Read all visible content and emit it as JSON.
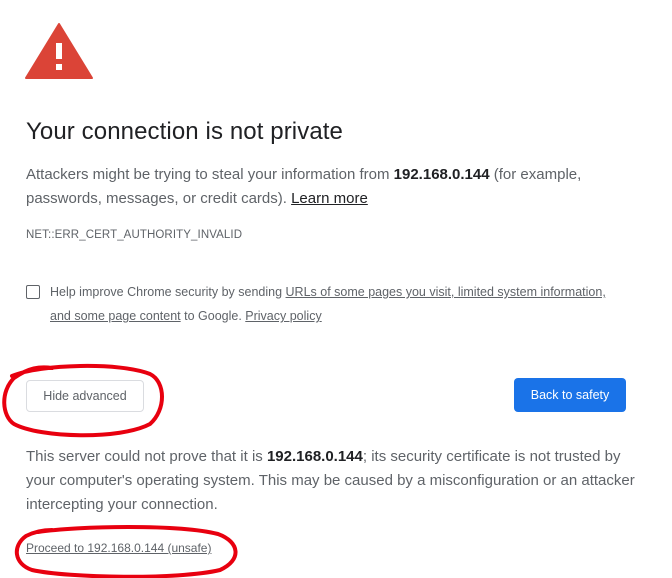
{
  "interstitial": {
    "headline": "Your connection is not private",
    "main_text": {
      "prefix": "Attackers might be trying to steal your information from ",
      "host": "192.168.0.144",
      "suffix": " (for example, passwords, messages, or credit cards). ",
      "learn_more": "Learn more"
    },
    "error_code": "NET::ERR_CERT_AUTHORITY_INVALID",
    "opt_in": {
      "checked": false,
      "prefix": "Help improve Chrome security by sending ",
      "link_text": "URLs of some pages you visit, limited system information, and some page content",
      "middle": " to Google. ",
      "privacy_policy": "Privacy policy"
    },
    "buttons": {
      "hide_advanced": "Hide advanced",
      "back_to_safety": "Back to safety"
    },
    "details": {
      "prefix": "This server could not prove that it is ",
      "host": "192.168.0.144",
      "suffix": "; its security certificate is not trusted by your computer's operating system. This may be caused by a misconfiguration or an attacker intercepting your connection."
    },
    "proceed_link": "Proceed to 192.168.0.144 (unsafe)"
  },
  "colors": {
    "warning_red": "#db4437",
    "primary_blue": "#1a73e8",
    "annotation_red": "#e8000f",
    "text_secondary": "#5f6368",
    "text_primary": "#202124"
  },
  "icons": {
    "warning": "warning-triangle-icon"
  }
}
